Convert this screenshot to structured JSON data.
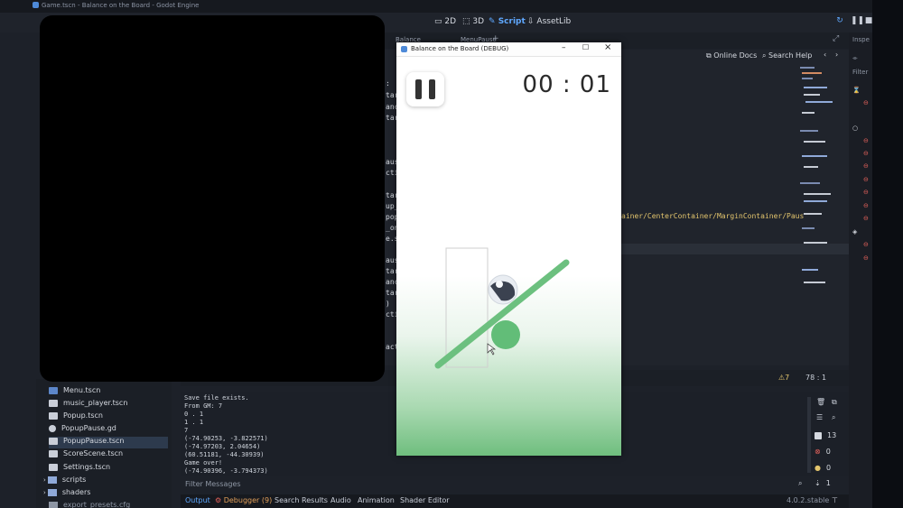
{
  "window": {
    "title": "Game.tscn - Balance on the Board - Godot Engine"
  },
  "workspaces": [
    {
      "label": "2D"
    },
    {
      "label": "3D"
    },
    {
      "label": "Script"
    },
    {
      "label": "AssetLib"
    }
  ],
  "script_tabs": {
    "tab1": "Balance",
    "tab2": "MenuPause"
  },
  "code_fragments": [
    ":",
    "tar",
    "anc",
    "tar",
    "aus",
    "cti",
    "tar",
    "up_",
    "pop",
    "_on",
    "e.s",
    "aus",
    "tar",
    "anc",
    "tar",
    ")",
    "cti",
    "act"
  ],
  "code_path": "ainer/CenterContainer/MarginContainer/Paus",
  "docs": {
    "online_docs": "Online Docs",
    "search_help": "Search Help"
  },
  "status": {
    "warnings": "7",
    "position": "78 :   1"
  },
  "inspector": {
    "title": "Inspe",
    "filter": "Filter"
  },
  "filesystem": {
    "files": [
      {
        "name": "Menu.tscn",
        "type": "scene"
      },
      {
        "name": "music_player.tscn",
        "type": "scene"
      },
      {
        "name": "Popup.tscn",
        "type": "scene"
      },
      {
        "name": "PopupPause.gd",
        "type": "script"
      },
      {
        "name": "PopupPause.tscn",
        "type": "scene",
        "selected": true
      },
      {
        "name": "ScoreScene.tscn",
        "type": "scene"
      },
      {
        "name": "Settings.tscn",
        "type": "scene"
      }
    ],
    "folders": [
      {
        "name": "scripts"
      },
      {
        "name": "shaders"
      }
    ],
    "partial_item": "export_presets.cfg"
  },
  "output": {
    "lines": [
      "Save file exists.",
      "From GM: 7",
      "0 . 1",
      "1 . 1",
      "7",
      "(-74.90253, -3.822571)",
      "(-74.97203, 2.04654)",
      "(60.51181, -44.30939)",
      "Game over!",
      "(-74.90396, -3.794373)"
    ],
    "filter_placeholder": "Filter Messages",
    "counts": {
      "messages": "13",
      "errors": "0",
      "warnings": "0",
      "info": "1"
    }
  },
  "bottom_tabs": [
    {
      "label": "Output"
    },
    {
      "label": "Debugger (9)"
    },
    {
      "label": "Search Results"
    },
    {
      "label": "Audio"
    },
    {
      "label": "Animation"
    },
    {
      "label": "Shader Editor"
    }
  ],
  "version": "4.0.2.stable",
  "game": {
    "window_title": "Balance on the Board (DEBUG)",
    "timer": "00 : 01",
    "colors": {
      "board": "#6cc07f",
      "circle": "#62bd78",
      "gradient_bottom": "#6fbe7e"
    }
  }
}
